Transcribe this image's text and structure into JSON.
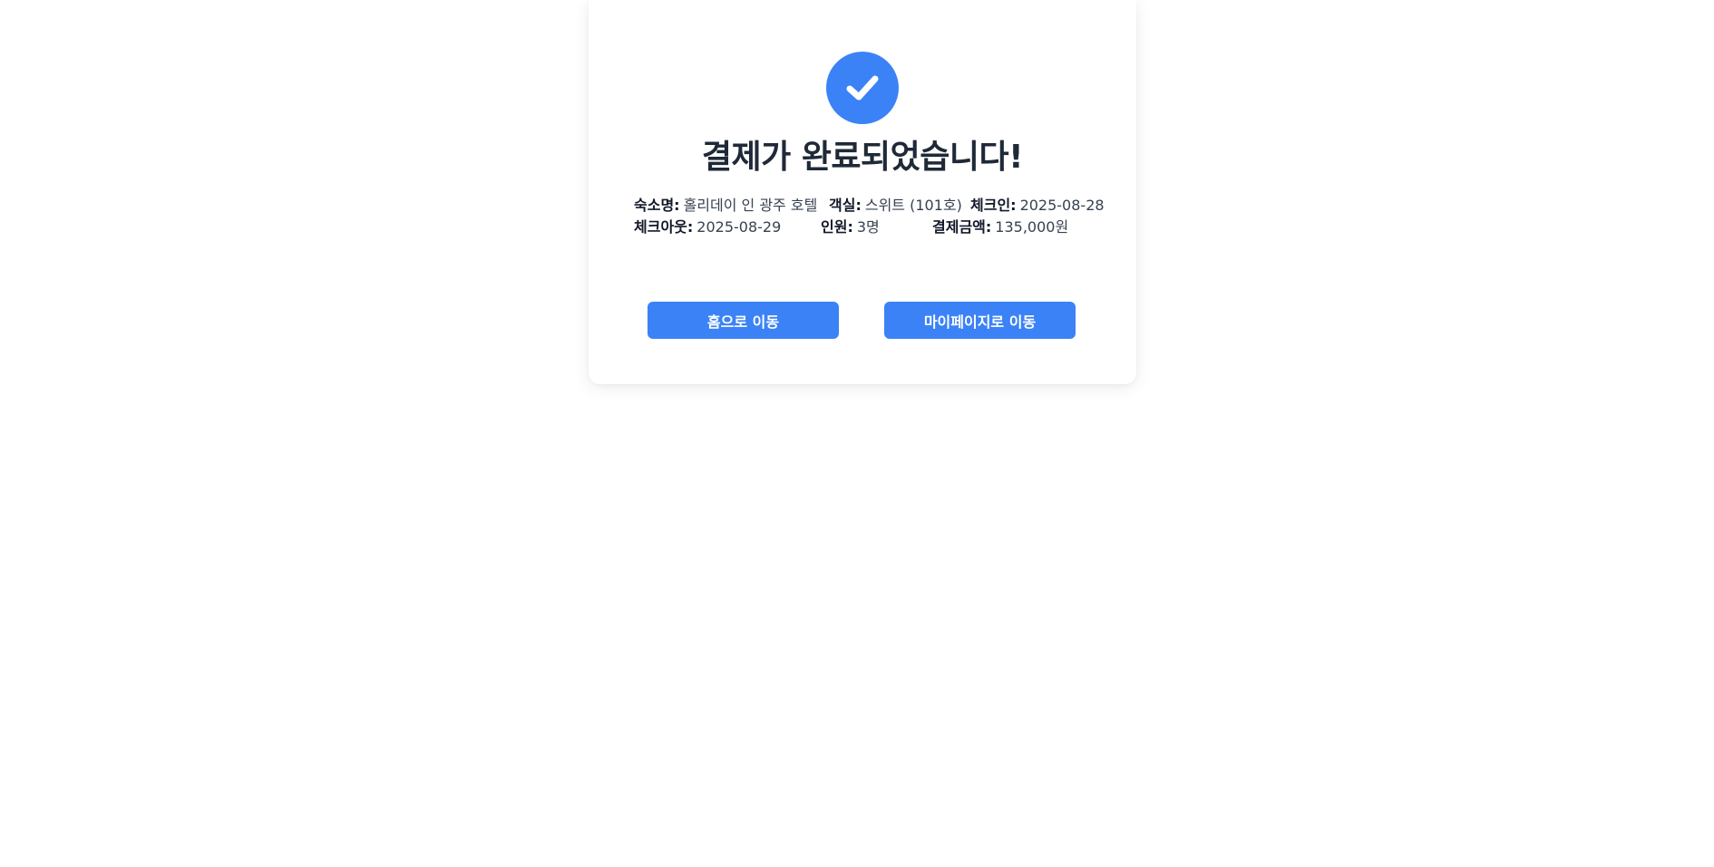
{
  "title": "결제가 완료되었습니다!",
  "icons": {
    "success": "check-circle-icon"
  },
  "colors": {
    "accent": "#3b82f6"
  },
  "booking": {
    "accommodation": {
      "label": "숙소명:",
      "value": "홀리데이 인 광주 호텔"
    },
    "room": {
      "label": "객실:",
      "value": "스위트 (101호)"
    },
    "checkin": {
      "label": "체크인:",
      "value": "2025-08-28"
    },
    "checkout": {
      "label": "체크아웃:",
      "value": "2025-08-29"
    },
    "guests": {
      "label": "인원:",
      "value": "3명"
    },
    "amount": {
      "label": "결제금액:",
      "value": "135,000원"
    }
  },
  "actions": {
    "home_label": "홈으로 이동",
    "mypage_label": "마이페이지로 이동"
  }
}
